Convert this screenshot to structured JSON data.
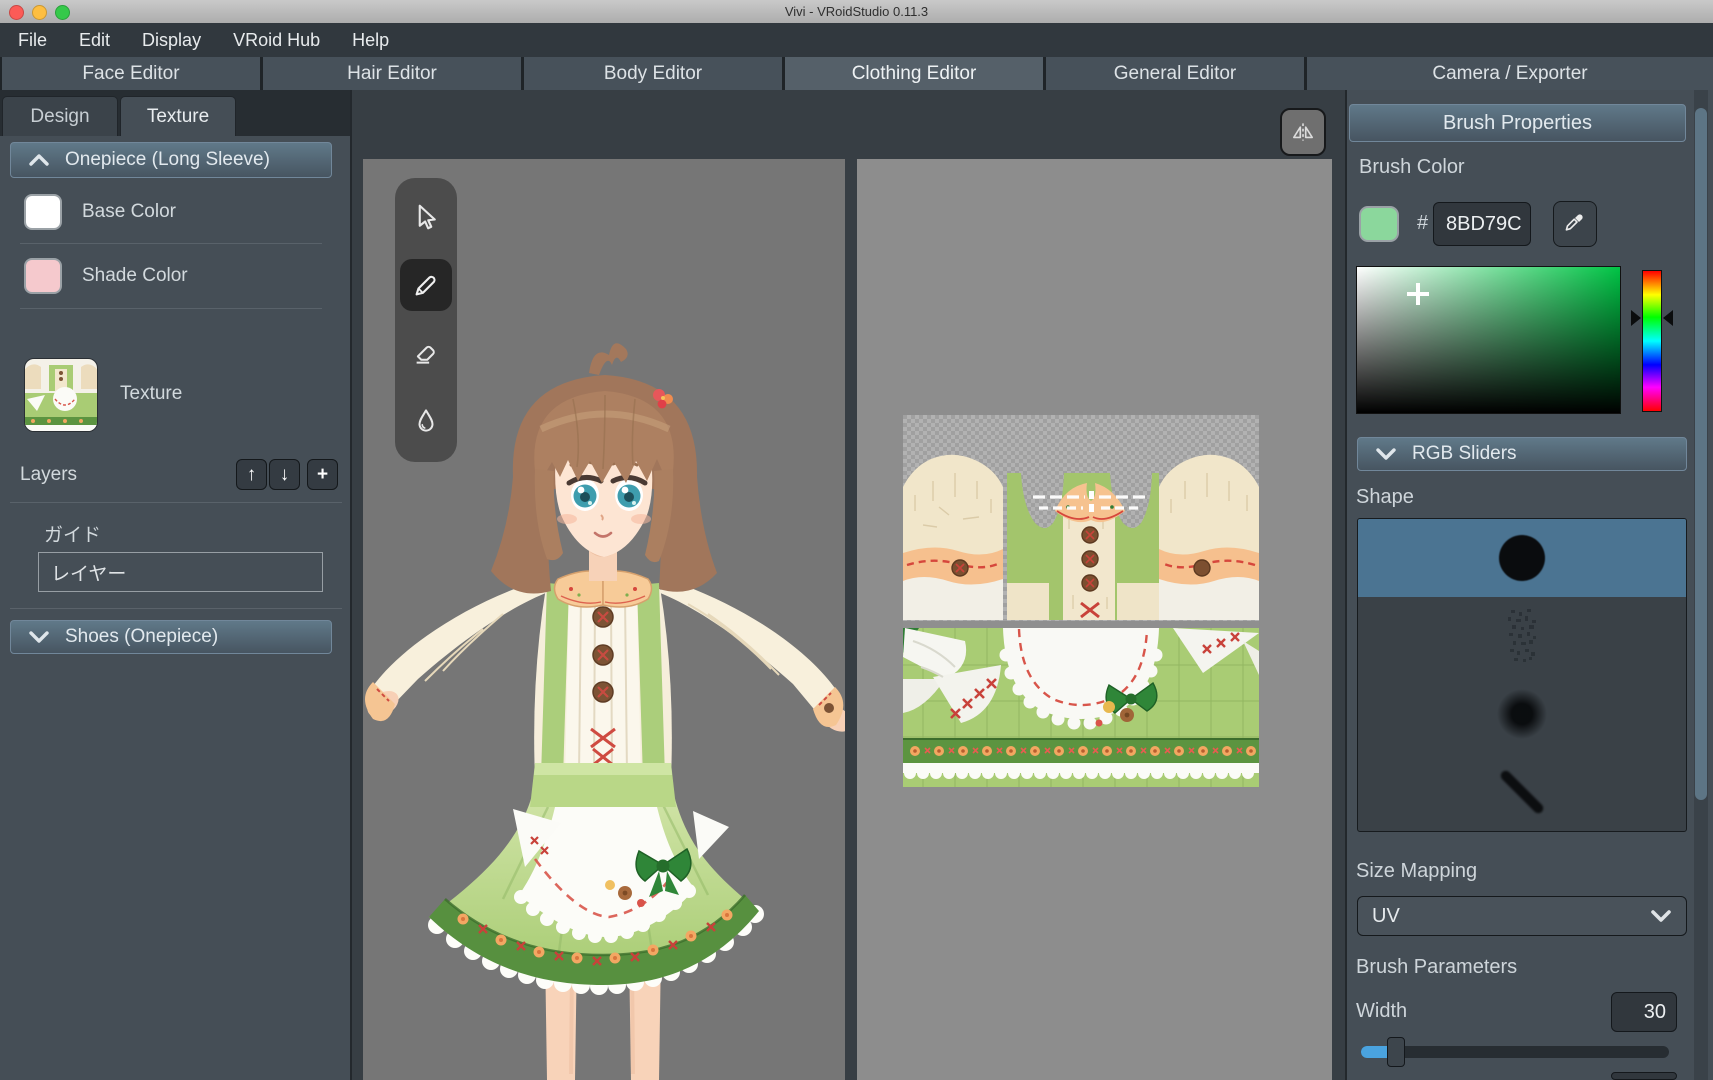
{
  "window": {
    "title": "Vivi - VRoidStudio 0.11.3"
  },
  "menu": {
    "items": [
      "File",
      "Edit",
      "Display",
      "VRoid Hub",
      "Help"
    ]
  },
  "editor_tabs": [
    {
      "label": "Face Editor",
      "active": false
    },
    {
      "label": "Hair Editor",
      "active": false
    },
    {
      "label": "Body Editor",
      "active": false
    },
    {
      "label": "Clothing Editor",
      "active": true
    },
    {
      "label": "General Editor",
      "active": false
    },
    {
      "label": "Camera / Exporter",
      "active": false
    }
  ],
  "left_panel": {
    "tabs": [
      {
        "label": "Design",
        "active": false
      },
      {
        "label": "Texture",
        "active": true
      }
    ],
    "onepiece_section": {
      "title": "Onepiece (Long Sleeve)"
    },
    "base_color": {
      "label": "Base Color",
      "swatch": "#ffffff"
    },
    "shade_color": {
      "label": "Shade Color",
      "swatch": "#f5c9cd"
    },
    "texture_item": {
      "label": "Texture"
    },
    "layers": {
      "label": "Layers",
      "move_up": "↑",
      "move_down": "↓",
      "add": "+",
      "guide_group": "ガイド",
      "layer_item": "レイヤー"
    },
    "shoes_section": {
      "title": "Shoes (Onepiece)"
    }
  },
  "toolbar": {
    "tools": [
      "select",
      "pencil",
      "eraser",
      "blend"
    ],
    "active_tool": "pencil"
  },
  "brush_panel": {
    "title": "Brush Properties",
    "brush_color": {
      "label": "Brush Color",
      "hash": "#",
      "hex": "8BD79C",
      "swatch": "#8bd79c",
      "picker_hue": "#00c445"
    },
    "rgb_sliders": {
      "title": "RGB Sliders"
    },
    "shape": {
      "label": "Shape",
      "selected": "circle",
      "options": [
        "circle",
        "noise",
        "soft-round",
        "stroke"
      ]
    },
    "size_mapping": {
      "label": "Size Mapping",
      "value": "UV"
    },
    "brush_parameters": {
      "title": "Brush Parameters",
      "width_label": "Width",
      "width_value": "30"
    }
  }
}
